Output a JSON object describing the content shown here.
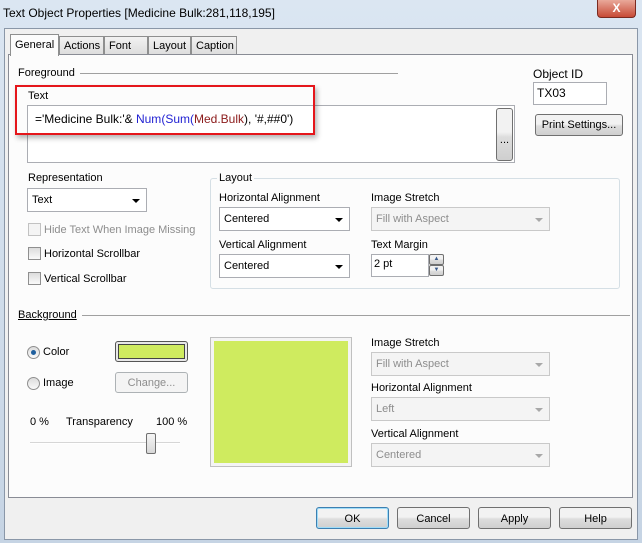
{
  "window": {
    "title": "Text Object Properties [Medicine Bulk:281,118,195]",
    "close_label": "X"
  },
  "tabs": [
    {
      "label": "General",
      "selected": true
    },
    {
      "label": "Actions"
    },
    {
      "label": "Font"
    },
    {
      "label": "Layout"
    },
    {
      "label": "Caption"
    }
  ],
  "foreground": {
    "section_label": "Foreground",
    "text_label": "Text",
    "expression": {
      "prefix": "='Medicine Bulk:'& ",
      "fn1": "Num",
      "p1": "(",
      "fn2": "Sum",
      "p2": "(",
      "field": "Med.Bulk",
      "suffix": "), '#,##0')"
    },
    "ellipsis_label": "...",
    "object_id_label": "Object ID",
    "object_id_value": "TX03",
    "print_settings_label": "Print Settings..."
  },
  "representation": {
    "label": "Representation",
    "value": "Text",
    "hide_text": {
      "label": "Hide Text When Image Missing",
      "checked": false,
      "disabled": true
    },
    "horizontal_scrollbar": {
      "label": "Horizontal Scrollbar",
      "checked": false
    },
    "vertical_scrollbar": {
      "label": "Vertical Scrollbar",
      "checked": false
    }
  },
  "layout": {
    "group_label": "Layout",
    "horizontal_alignment": {
      "label": "Horizontal Alignment",
      "value": "Centered"
    },
    "vertical_alignment": {
      "label": "Vertical Alignment",
      "value": "Centered"
    },
    "image_stretch": {
      "label": "Image Stretch",
      "value": "Fill with Aspect"
    },
    "text_margin": {
      "label": "Text Margin",
      "value": "2 pt"
    }
  },
  "background": {
    "section_label": "Background",
    "color_label": "Color",
    "color_selected": true,
    "color_value": "#cfeb5f",
    "image_label": "Image",
    "change_label": "Change...",
    "transparency": {
      "min_label": "0 %",
      "label": "Transparency",
      "max_label": "100 %",
      "value_percent": 80
    },
    "image_stretch": {
      "label": "Image Stretch",
      "value": "Fill with Aspect"
    },
    "horizontal_alignment": {
      "label": "Horizontal Alignment",
      "value": "Left"
    },
    "vertical_alignment": {
      "label": "Vertical Alignment",
      "value": "Centered"
    }
  },
  "buttons": {
    "ok": "OK",
    "cancel": "Cancel",
    "apply": "Apply",
    "help": "Help"
  },
  "colors": {
    "highlight_box": "#e5161b",
    "keyword": "#1f1fd2",
    "field": "#8b1a1a"
  }
}
